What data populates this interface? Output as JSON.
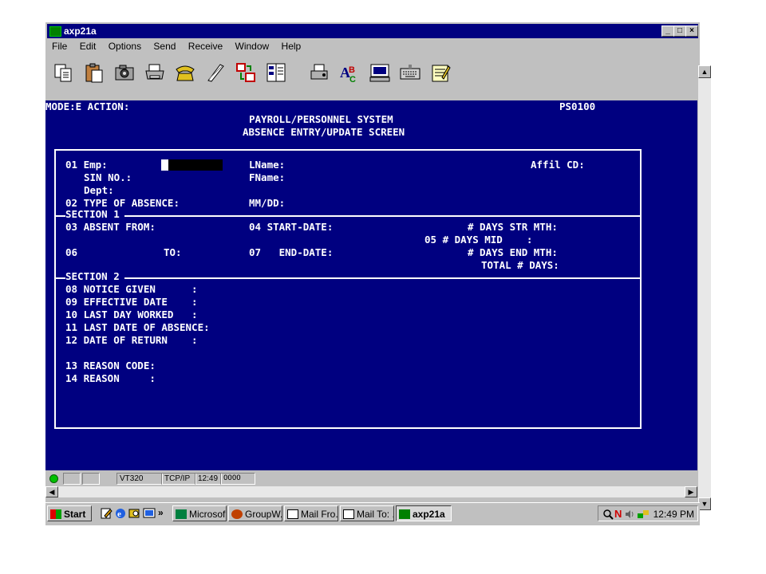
{
  "window": {
    "title": "axp21a",
    "min_label": "_",
    "max_label": "□",
    "close_label": "×"
  },
  "menu": [
    "File",
    "Edit",
    "Options",
    "Send",
    "Receive",
    "Window",
    "Help"
  ],
  "toolbar_icons": [
    "copy-icon",
    "paste-icon",
    "camera-icon",
    "printer-icon",
    "phone-icon",
    "modem-icon",
    "transfer-icon",
    "layout-icon",
    "print-screen-icon",
    "spell-check-icon",
    "terminal-icon",
    "keyboard-icon",
    "notepad-icon"
  ],
  "screen": {
    "mode": "MODE:E ACTION:",
    "screen_id": "PS0100",
    "system_title": "PAYROLL/PERSONNEL SYSTEM",
    "screen_title": "ABSENCE ENTRY/UPDATE SCREEN",
    "emp": "01 Emp:",
    "lname": "LName:",
    "affil": "Affil CD:",
    "sin": "SIN NO.:",
    "fname": "FName:",
    "dept": "Dept:",
    "type": "02 TYPE OF ABSENCE:",
    "mmdd": "MM/DD:",
    "section1": "SECTION 1",
    "absent_from": "03 ABSENT FROM:",
    "start_date": "04 START-DATE:",
    "days_str": "# DAYS STR MTH:",
    "days_mid": "05 # DAYS MID    :",
    "to_num": "06",
    "to_label": "TO:",
    "end_date": "07   END-DATE:",
    "days_end": "# DAYS END MTH:",
    "total_days": "TOTAL # DAYS:",
    "section2": "SECTION 2",
    "f08": "08 NOTICE GIVEN      :",
    "f09": "09 EFFECTIVE DATE    :",
    "f10": "10 LAST DAY WORKED   :",
    "f11": "11 LAST DATE OF ABSENCE:",
    "f12": "12 DATE OF RETURN    :",
    "f13": "13 REASON CODE:",
    "f14": "14 REASON     :"
  },
  "status": {
    "terminal": "VT320",
    "protocol": "TCP/IP",
    "time": "12:49",
    "leds": "OOOO"
  },
  "taskbar": {
    "start": "Start",
    "chevron": "»",
    "tasks": [
      "Microsof...",
      "GroupW...",
      "Mail Fro...",
      "Mail To: ...",
      "axp21a"
    ],
    "clock": "12:49 PM"
  },
  "colors": {
    "terminal_bg": "#000080",
    "terminal_fg": "#ffffff",
    "titlebar": "#000080"
  }
}
